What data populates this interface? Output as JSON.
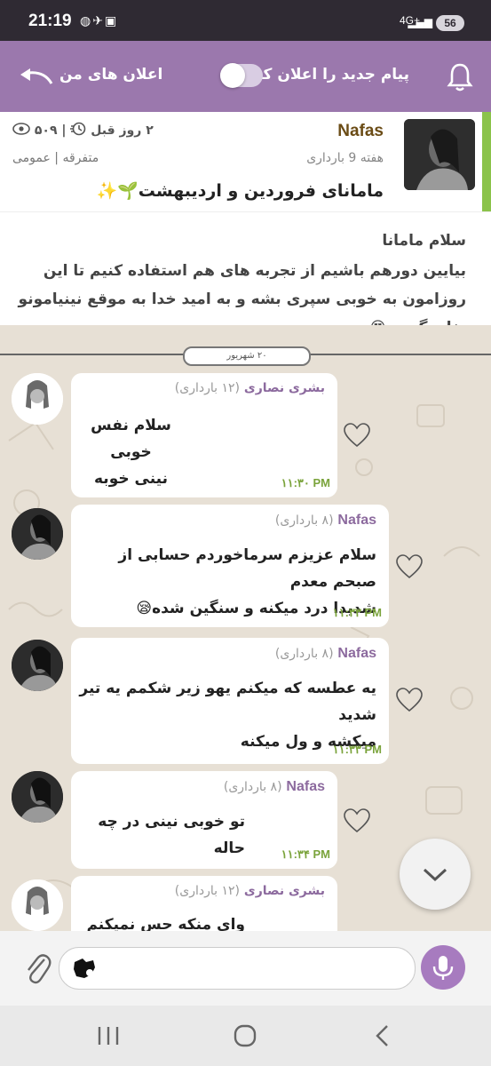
{
  "status_bar": {
    "time": "21:19",
    "network": "4G+",
    "battery": "56"
  },
  "header": {
    "notify_label": "پیام جدید را اعلان کن",
    "toggle_on": false,
    "my_ads_label": "اعلان های من",
    "bar_color": "#9b78ad"
  },
  "post": {
    "author": "Nafas",
    "week": "هفته 9 بارداری",
    "title": "مامانای فروردین و اردیبهشت🌱✨",
    "time_ago": "۲ روز قبل",
    "views": "۵۰۹",
    "category": "متفرقه | عمومی"
  },
  "intro": {
    "greeting": "سلام مامانا",
    "body": "بیایین دورهم باشیم از تجربه های هم استفاده کنیم تا این روزامون به خوبی سپری بشه و به امید خدا به موقع نینیامونو بغل بگیریم😍"
  },
  "chat": {
    "date_chip": "۲۰ شهریور",
    "messages": [
      {
        "sender": "بشری نصاری",
        "week": "(۱۲ بارداری)",
        "lines": [
          "سلام نفس خوبی",
          "نینی خوبه"
        ],
        "time": "۱۱:۳۰ PM"
      },
      {
        "sender": "Nafas",
        "week": "(۸ بارداری)",
        "lines": [
          "سلام عزیزم سرماخوردم حسابی از صبحم معدم",
          "شدیدا درد میکنه و سنگین شده😪"
        ],
        "time": "۱۱:۳۳ PM"
      },
      {
        "sender": "Nafas",
        "week": "(۸ بارداری)",
        "lines": [
          "یه عطسه که میکنم یهو زیر شکمم یه تیر شدید",
          "میکشه و ول میکنه"
        ],
        "time": "۱۱:۳۳ PM"
      },
      {
        "sender": "Nafas",
        "week": "(۸ بارداری)",
        "lines": [
          "تو خوبی نینی در چه حاله"
        ],
        "time": "۱۱:۳۴ PM"
      },
      {
        "sender": "بشری نصاری",
        "week": "(۱۲ بارداری)",
        "lines": [
          "وای منکه حس نمیکنم باردارم😑"
        ],
        "time": ""
      }
    ]
  },
  "composer": {
    "input_value": ""
  },
  "colors": {
    "accent_green": "#8bc34a",
    "time_green": "#7aa33b",
    "sender_purple": "#8c6a9e"
  },
  "icons": [
    "bell-icon",
    "back-arrow-icon",
    "eye-icon",
    "clock-icon",
    "heart-icon",
    "chevron-down-icon",
    "paperclip-icon",
    "mic-icon",
    "recents-icon",
    "home-icon",
    "back-icon"
  ]
}
